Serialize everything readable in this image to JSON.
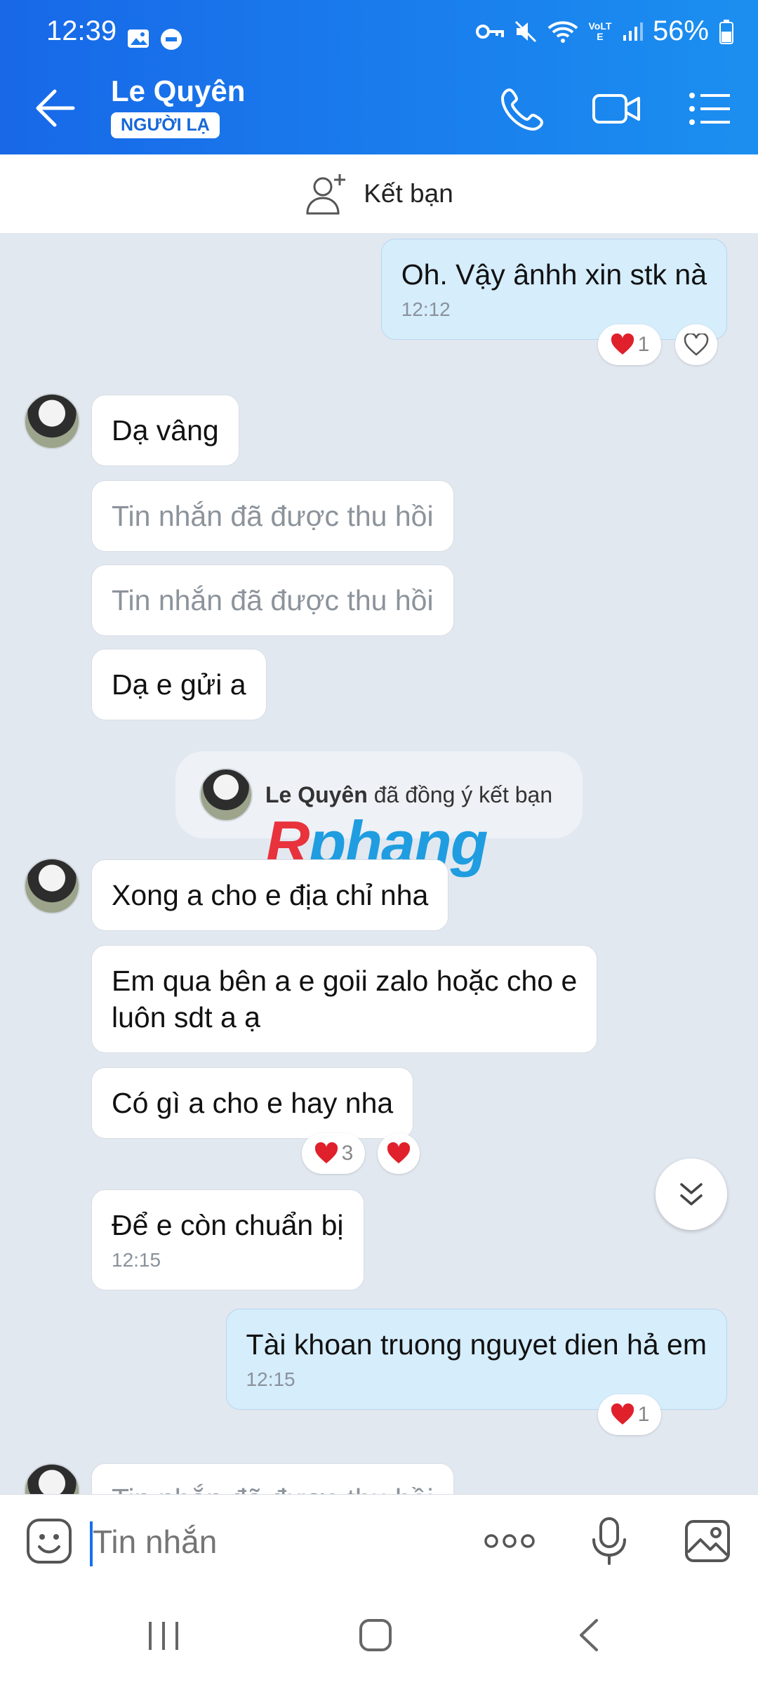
{
  "status_bar": {
    "time": "12:39",
    "battery": "56%",
    "network": "VoLTE"
  },
  "header": {
    "contact_name": "Le Quyên",
    "badge": "NGƯỜI LẠ"
  },
  "friend_bar": {
    "label": "Kết bạn"
  },
  "messages": [
    {
      "dir": "out",
      "text": "Oh. Vậy ânhh xin stk nà",
      "time": "12:12",
      "reaction_count": "1"
    },
    {
      "dir": "in",
      "text": "Dạ vâng"
    },
    {
      "dir": "in",
      "text": "Tin nhắn đã được thu hồi",
      "recalled": true
    },
    {
      "dir": "in",
      "text": "Tin nhắn đã được thu hồi",
      "recalled": true
    },
    {
      "dir": "in",
      "text": "Dạ e gửi a"
    },
    {
      "dir": "in",
      "text": "Xong a cho e địa chỉ nha"
    },
    {
      "dir": "in",
      "text_line1": "Em qua bên a e goii zalo hoặc cho e",
      "text_line2": "luôn sdt a ạ"
    },
    {
      "dir": "in",
      "text": "Có gì a cho e hay nha",
      "reaction_count": "3"
    },
    {
      "dir": "in",
      "text": "Để e còn chuẩn bị",
      "time": "12:15"
    },
    {
      "dir": "out",
      "text": "Tài khoan truong nguyet dien hả em",
      "time": "12:15",
      "reaction_count": "1"
    },
    {
      "dir": "in",
      "text": "Tin nhắn đã được thu hồi",
      "recalled": true
    }
  ],
  "system_message": {
    "name": "Le Quyên",
    "text": " đã đồng ý kết bạn"
  },
  "watermark": {
    "text": "Rphang"
  },
  "composer": {
    "placeholder": "Tin nhắn"
  },
  "colors": {
    "header": "#1b7cf0",
    "outgoing_bubble": "#d6edfc",
    "chat_bg": "#e2e8f0",
    "heart": "#e0202b"
  }
}
